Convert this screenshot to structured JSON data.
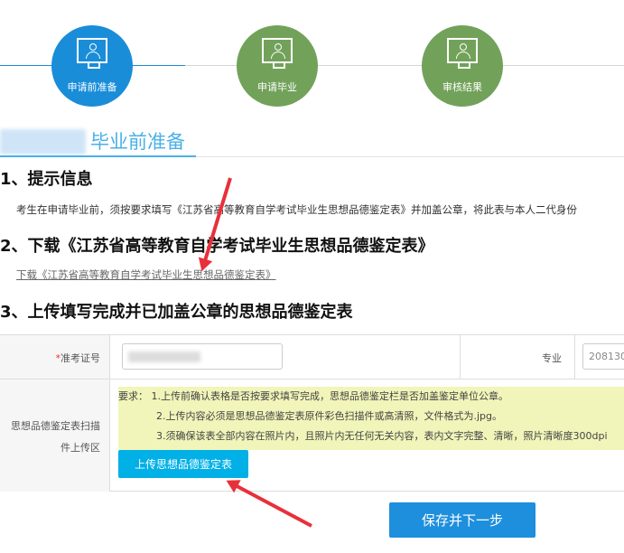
{
  "steps": [
    {
      "label": "申请前准备",
      "state": "active"
    },
    {
      "label": "申请毕业",
      "state": "pending"
    },
    {
      "label": "审核结果",
      "state": "pending"
    }
  ],
  "colors": {
    "active": "#1a8dd9",
    "pending": "#72a25a",
    "accent": "#4ab0e8",
    "upload": "#00b0e6",
    "save": "#1e8fdc"
  },
  "section_title": "毕业前准备",
  "s1": {
    "title": "1、提示信息",
    "text": "考生在申请毕业前，须按要求填写《江苏省高等教育自学考试毕业生思想品德鉴定表》并加盖公章，将此表与本人二代身份"
  },
  "s2": {
    "title": "2、下载《江苏省高等教育自学考试毕业生思想品德鉴定表》",
    "link": "下载《江苏省高等教育自学考试毕业生思想品德鉴定表》"
  },
  "s3": {
    "title": "3、上传填写完成并已加盖公章的思想品德鉴定表"
  },
  "form": {
    "required_mark": "*",
    "exam_id_label": "准考证号",
    "major_label": "专业",
    "major_value": "208130",
    "upload_area_label": "思想品德鉴定表扫描件上传区",
    "req1": "要求： 1.上传前确认表格是否按要求填写完成，思想品德鉴定栏是否加盖鉴定单位公章。",
    "req2": "2.上传内容必须是思想品德鉴定表原件彩色扫描件或高清照，文件格式为.jpg。",
    "req3": "3.须确保该表全部内容在照片内，且照片内无任何无关内容，表内文字完整、清晰，照片清晰度300dpi",
    "upload_button": "上传思想品德鉴定表"
  },
  "save_button": "保存并下一步"
}
